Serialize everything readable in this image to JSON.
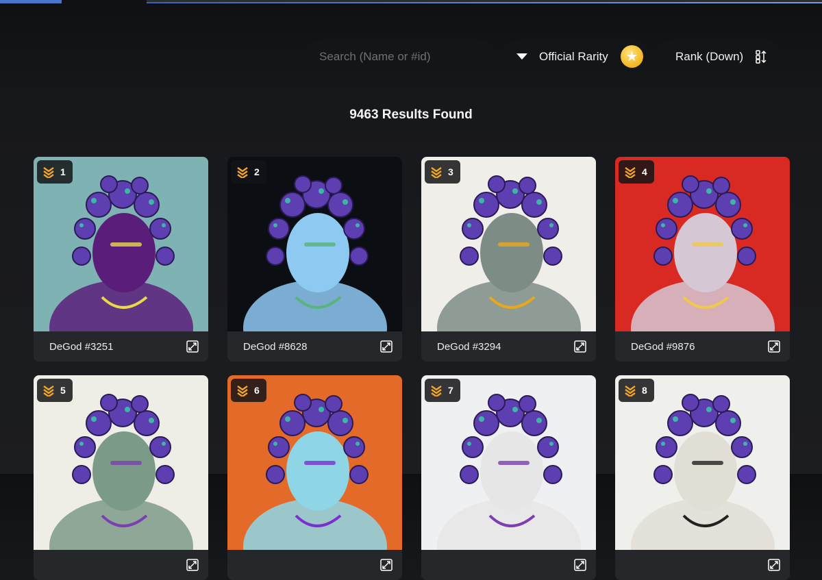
{
  "search": {
    "placeholder": "Search (Name or #id)"
  },
  "filters": {
    "rarity_label": "Official Rarity",
    "sort_label": "Rank (Down)"
  },
  "results_text": "9463 Results Found",
  "cards": [
    {
      "rank": "1",
      "name": "DeGod #3251",
      "bg": "#7fb3b3",
      "skin": "#5a1e7a",
      "accent": "#e8d84a"
    },
    {
      "rank": "2",
      "name": "DeGod #8628",
      "bg": "#0b0f14",
      "skin": "#8ec9f2",
      "accent": "#59b37a"
    },
    {
      "rank": "3",
      "name": "DeGod #3294",
      "bg": "#efeee8",
      "skin": "#7d8d86",
      "accent": "#e8a81a"
    },
    {
      "rank": "4",
      "name": "DeGod #9876",
      "bg": "#d82a22",
      "skin": "#d6c7d4",
      "accent": "#f0c84a"
    },
    {
      "rank": "5",
      "name": "",
      "bg": "#eeede6",
      "skin": "#7c9a88",
      "accent": "#7c3fb0"
    },
    {
      "rank": "6",
      "name": "",
      "bg": "#e46a2a",
      "skin": "#8ed6e6",
      "accent": "#7b2fd0"
    },
    {
      "rank": "7",
      "name": "",
      "bg": "#eef0f2",
      "skin": "#e6e6e6",
      "accent": "#7c3fb0"
    },
    {
      "rank": "8",
      "name": "",
      "bg": "#efefeb",
      "skin": "#e1ded6",
      "accent": "#222222"
    }
  ],
  "colors": {
    "badge_chevron": "#f1a52a",
    "star": "#f2b51e"
  }
}
